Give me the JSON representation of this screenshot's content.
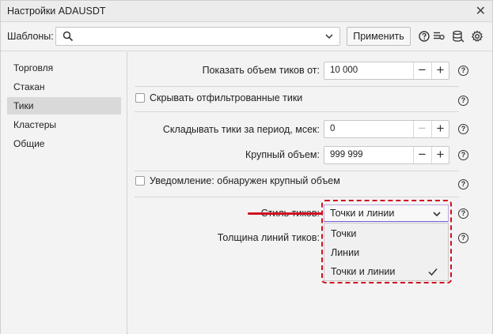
{
  "window": {
    "title": "Настройки ADAUSDT"
  },
  "templates": {
    "label": "Шаблоны:",
    "value": "",
    "apply_label": "Применить"
  },
  "icons": {
    "close": "close-icon",
    "search": "search-icon",
    "chevron": "chevron-down-icon",
    "help": "help-icon",
    "list": "list-icon",
    "database": "database-icon",
    "gear": "gear-icon",
    "check": "checkmark-icon"
  },
  "sidebar": {
    "items": [
      {
        "label": "Торговля",
        "active": false
      },
      {
        "label": "Стакан",
        "active": false
      },
      {
        "label": "Тики",
        "active": true
      },
      {
        "label": "Кластеры",
        "active": false
      },
      {
        "label": "Общие",
        "active": false
      }
    ]
  },
  "settings": {
    "show_volume": {
      "label": "Показать объем тиков от:",
      "value": "10 000"
    },
    "hide_filtered": {
      "label": "Скрывать отфильтрованные тики",
      "checked": false
    },
    "fold_ticks": {
      "label": "Складывать тики за период, мсек:",
      "value": "0"
    },
    "large_volume": {
      "label": "Крупный объем:",
      "value": "999 999"
    },
    "notify_large": {
      "label": "Уведомление: обнаружен крупный объем",
      "checked": false
    },
    "tick_style": {
      "label": "Стиль тиков:",
      "value": "Точки и линии",
      "options": [
        "Точки",
        "Линии",
        "Точки и линии"
      ],
      "selected": "Точки и линии"
    },
    "line_width": {
      "label": "Толщина линий тиков:"
    }
  },
  "help_glyph": "?",
  "stepper": {
    "minus": "−",
    "plus": "+"
  },
  "colors": {
    "annotation": "#cf1020",
    "accent": "#7a5cd6"
  }
}
